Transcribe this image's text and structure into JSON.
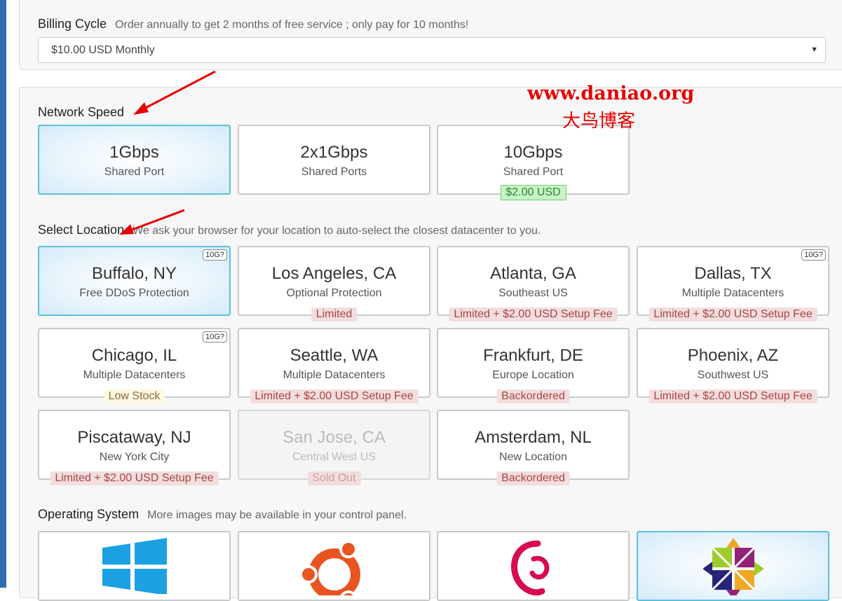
{
  "billing": {
    "title": "Billing Cycle",
    "hint": "Order annually to get 2 months of free service ; only pay for 10 months!",
    "selected": "$10.00 USD Monthly"
  },
  "network": {
    "title": "Network Speed",
    "options": [
      {
        "title": "1Gbps",
        "sub": "Shared Port",
        "selected": true
      },
      {
        "title": "2x1Gbps",
        "sub": "Shared Ports"
      },
      {
        "title": "10Gbps",
        "sub": "Shared Port",
        "badge": "$2.00 USD"
      }
    ]
  },
  "location": {
    "title": "Select Location",
    "hint": "We ask your browser for your location to auto-select the closest datacenter to you.",
    "corner_label": "10G?",
    "options": [
      {
        "title": "Buffalo, NY",
        "sub": "Free DDoS Protection",
        "corner": "10G?",
        "selected": true
      },
      {
        "title": "Los Angeles, CA",
        "sub": "Optional Protection",
        "badge": "Limited"
      },
      {
        "title": "Atlanta, GA",
        "sub": "Southeast US",
        "badge": "Limited + $2.00 USD Setup Fee"
      },
      {
        "title": "Dallas, TX",
        "sub": "Multiple Datacenters",
        "corner": "10G?",
        "badge": "Limited + $2.00 USD Setup Fee"
      },
      {
        "title": "Chicago, IL",
        "sub": "Multiple Datacenters",
        "corner": "10G?",
        "badge": "Low Stock"
      },
      {
        "title": "Seattle, WA",
        "sub": "Multiple Datacenters",
        "badge": "Limited + $2.00 USD Setup Fee"
      },
      {
        "title": "Frankfurt, DE",
        "sub": "Europe Location",
        "badge": "Backordered"
      },
      {
        "title": "Phoenix, AZ",
        "sub": "Southwest US",
        "badge": "Limited + $2.00 USD Setup Fee"
      },
      {
        "title": "Piscataway, NJ",
        "sub": "New York City",
        "badge": "Limited + $2.00 USD Setup Fee"
      },
      {
        "title": "San Jose, CA",
        "sub": "Central West US",
        "badge": "Sold Out",
        "disabled": true
      },
      {
        "title": "Amsterdam, NL",
        "sub": "New Location",
        "badge": "Backordered"
      }
    ]
  },
  "os": {
    "title": "Operating System",
    "hint": "More images may be available in your control panel.",
    "options": [
      {
        "icon": "windows-logo-icon"
      },
      {
        "icon": "ubuntu-logo-icon"
      },
      {
        "icon": "debian-logo-icon"
      },
      {
        "icon": "centos-logo-icon",
        "selected": true
      }
    ]
  },
  "watermark": {
    "url": "www.daniao.org",
    "name": "大鸟博客"
  },
  "colors": {
    "accent_border": "#5bc0de",
    "badge_red_bg": "#f2dede",
    "badge_red_text": "#a94442",
    "badge_green_bg": "#c8f3c8",
    "badge_yellow_bg": "#fcf8e3",
    "annotation_arrow": "#e60000",
    "sidebar_stripe": "#2f6fb0"
  }
}
